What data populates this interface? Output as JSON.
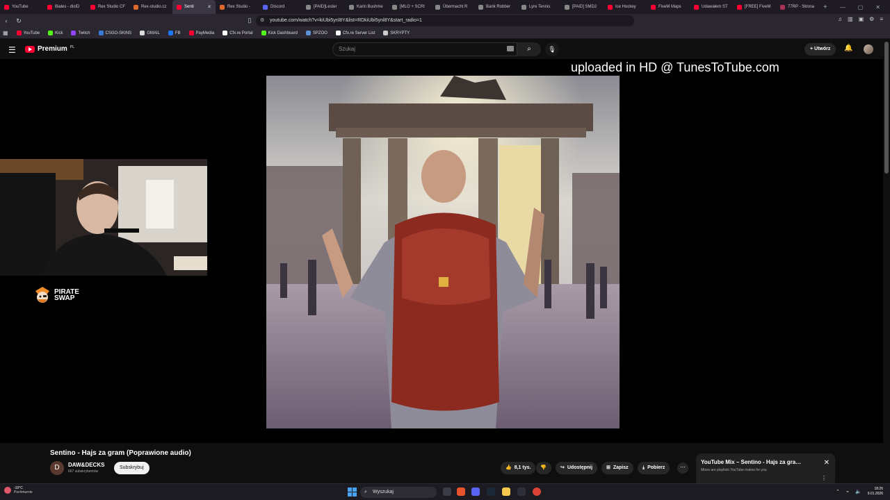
{
  "browser": {
    "tabs": [
      {
        "label": "YouTube",
        "color": "#ff0033"
      },
      {
        "label": "Biales - disID",
        "color": "#ff0033"
      },
      {
        "label": "Rex Studio CF",
        "color": "#ff0033"
      },
      {
        "label": "Rex-studio.cz",
        "color": "#e06a2b"
      },
      {
        "label": "Senti",
        "color": "#ff0033",
        "active": true
      },
      {
        "label": "Rex Studio - ",
        "color": "#e06a2b"
      },
      {
        "label": "Discord",
        "color": "#5865f2"
      },
      {
        "label": "[PAID]Lester",
        "color": "#888888"
      },
      {
        "label": "Karin Bushme",
        "color": "#888888"
      },
      {
        "label": "[MLO + SCRI",
        "color": "#888888"
      },
      {
        "label": "Übermacht R",
        "color": "#888888"
      },
      {
        "label": "Bank Robber",
        "color": "#888888"
      },
      {
        "label": "Lyre Tennis",
        "color": "#888888"
      },
      {
        "label": "[PAID] SMD2",
        "color": "#888888"
      },
      {
        "label": "Ice Hockey",
        "color": "#ff0033"
      },
      {
        "label": "FiveM Maps",
        "color": "#ff0033"
      },
      {
        "label": "Udawałem ST",
        "color": "#ff0033"
      },
      {
        "label": "[FREE] FiveM",
        "color": "#ff0033"
      },
      {
        "label": "77RP - Strona",
        "color": "#aa3355"
      }
    ],
    "new_tab": "+",
    "url": "youtube.com/watch?v=kiUbi5ynl8Y&list=RDkiUbi5ynl8Y&start_radio=1",
    "bookmarks": [
      {
        "label": "YouTube",
        "color": "#ff0033"
      },
      {
        "label": "Kick",
        "color": "#53fc18"
      },
      {
        "label": "Twitch",
        "color": "#9146ff"
      },
      {
        "label": "CSGO-SKINS",
        "color": "#3a7bd5"
      },
      {
        "label": "GMAIL",
        "color": "#dddddd"
      },
      {
        "label": "FB",
        "color": "#1877f2"
      },
      {
        "label": "PayMedia",
        "color": "#ff0033"
      },
      {
        "label": "Cfx.re Portal",
        "color": "#ffffff"
      },
      {
        "label": "Kick Dashboard",
        "color": "#53fc18"
      },
      {
        "label": "SPZOO",
        "color": "#5b8fd6"
      },
      {
        "label": "Cfx.re Server List",
        "color": "#ffffff"
      },
      {
        "label": "SKRYPTY",
        "color": "#cccccc"
      }
    ]
  },
  "youtube": {
    "logo_text": "Premium",
    "region": "PL",
    "search_placeholder": "Szukaj",
    "create_label": "Utwórz",
    "watermark": "uploaded in HD @ TunesToTube.com",
    "sponsor_line1": "PIRATE",
    "sponsor_line2": "SWAP",
    "video_title": "Sentino - Hajs za gram (Poprawione audio)",
    "channel_initial": "D",
    "channel_name": "DAW&DECKS",
    "channel_subs": "667 subskrybentów",
    "subscribe_label": "Subskrybuj",
    "likes": "8,1 tys.",
    "share_label": "Udostępnij",
    "save_label": "Zapisz",
    "download_label": "Pobierz",
    "mix_title": "YouTube Mix – Sentino - Hajs za gra…",
    "mix_subtitle": "Mixes are playlists YouTube makes for you"
  },
  "taskbar": {
    "temp": "-10°C",
    "weather": "Pochmurnie",
    "search_label": "Wyszukaj",
    "time": "18:26",
    "date": "9.01.2026"
  }
}
